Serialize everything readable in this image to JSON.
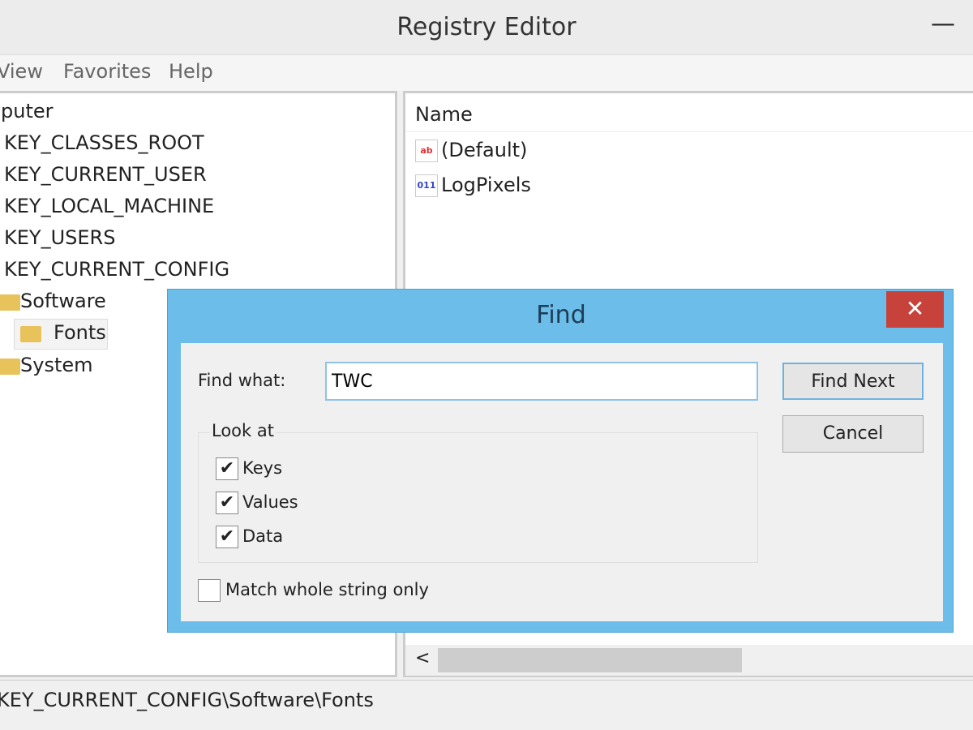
{
  "window": {
    "title": "Registry Editor",
    "minimize": "—"
  },
  "menu": [
    "View",
    "Favorites",
    "Help"
  ],
  "tree": [
    "puter",
    "KEY_CLASSES_ROOT",
    "KEY_CURRENT_USER",
    "KEY_LOCAL_MACHINE",
    "KEY_USERS",
    "KEY_CURRENT_CONFIG",
    "Software",
    "Fonts",
    "System"
  ],
  "list": {
    "header": "Name",
    "items": [
      {
        "name": "(Default)",
        "icon": "ab"
      },
      {
        "name": "LogPixels",
        "icon": "011"
      }
    ]
  },
  "scroll_left": "<",
  "status": "KEY_CURRENT_CONFIG\\Software\\Fonts",
  "find": {
    "title": "Find",
    "close": "✕",
    "find_what_label": "Find what:",
    "find_what_value": "TWC",
    "find_next": "Find Next",
    "cancel": "Cancel",
    "look_at": "Look at",
    "keys": "Keys",
    "values": "Values",
    "data": "Data",
    "match": "Match whole string only",
    "check": "✔"
  }
}
